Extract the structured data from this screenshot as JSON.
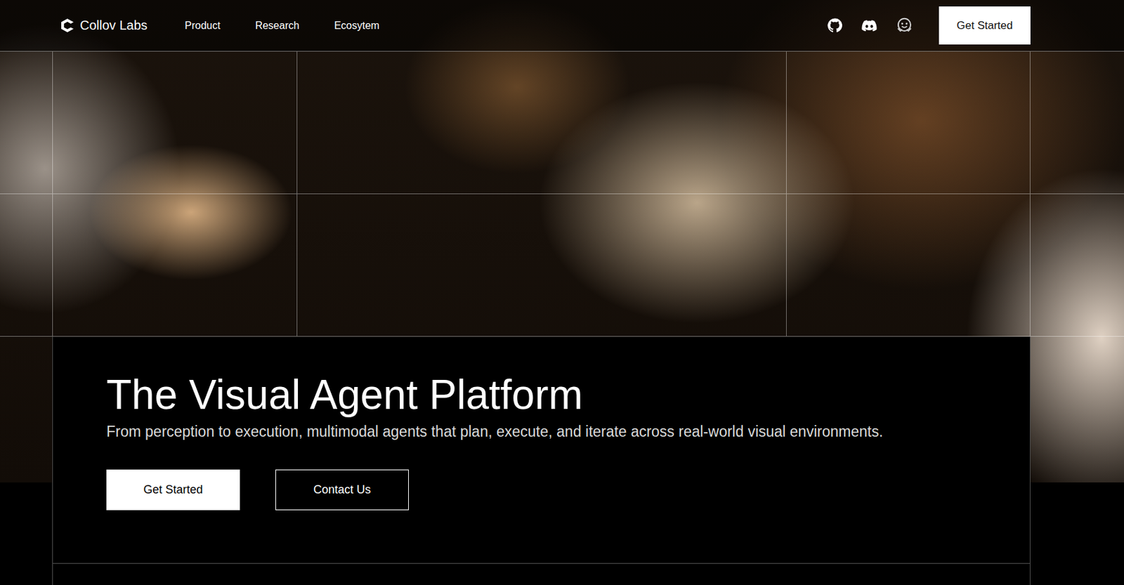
{
  "nav": {
    "logo": "Collov Labs",
    "links": [
      "Product",
      "Research",
      "Ecosytem"
    ],
    "cta": "Get Started"
  },
  "hero": {
    "title": "The Visual Agent Platform",
    "subtitle": "From perception to execution, multimodal agents that plan, execute, and iterate across real-world visual environments.",
    "buttons": [
      {
        "label": "Get Started",
        "kind": "primary"
      },
      {
        "label": "Contact Us",
        "kind": "outline"
      }
    ]
  }
}
